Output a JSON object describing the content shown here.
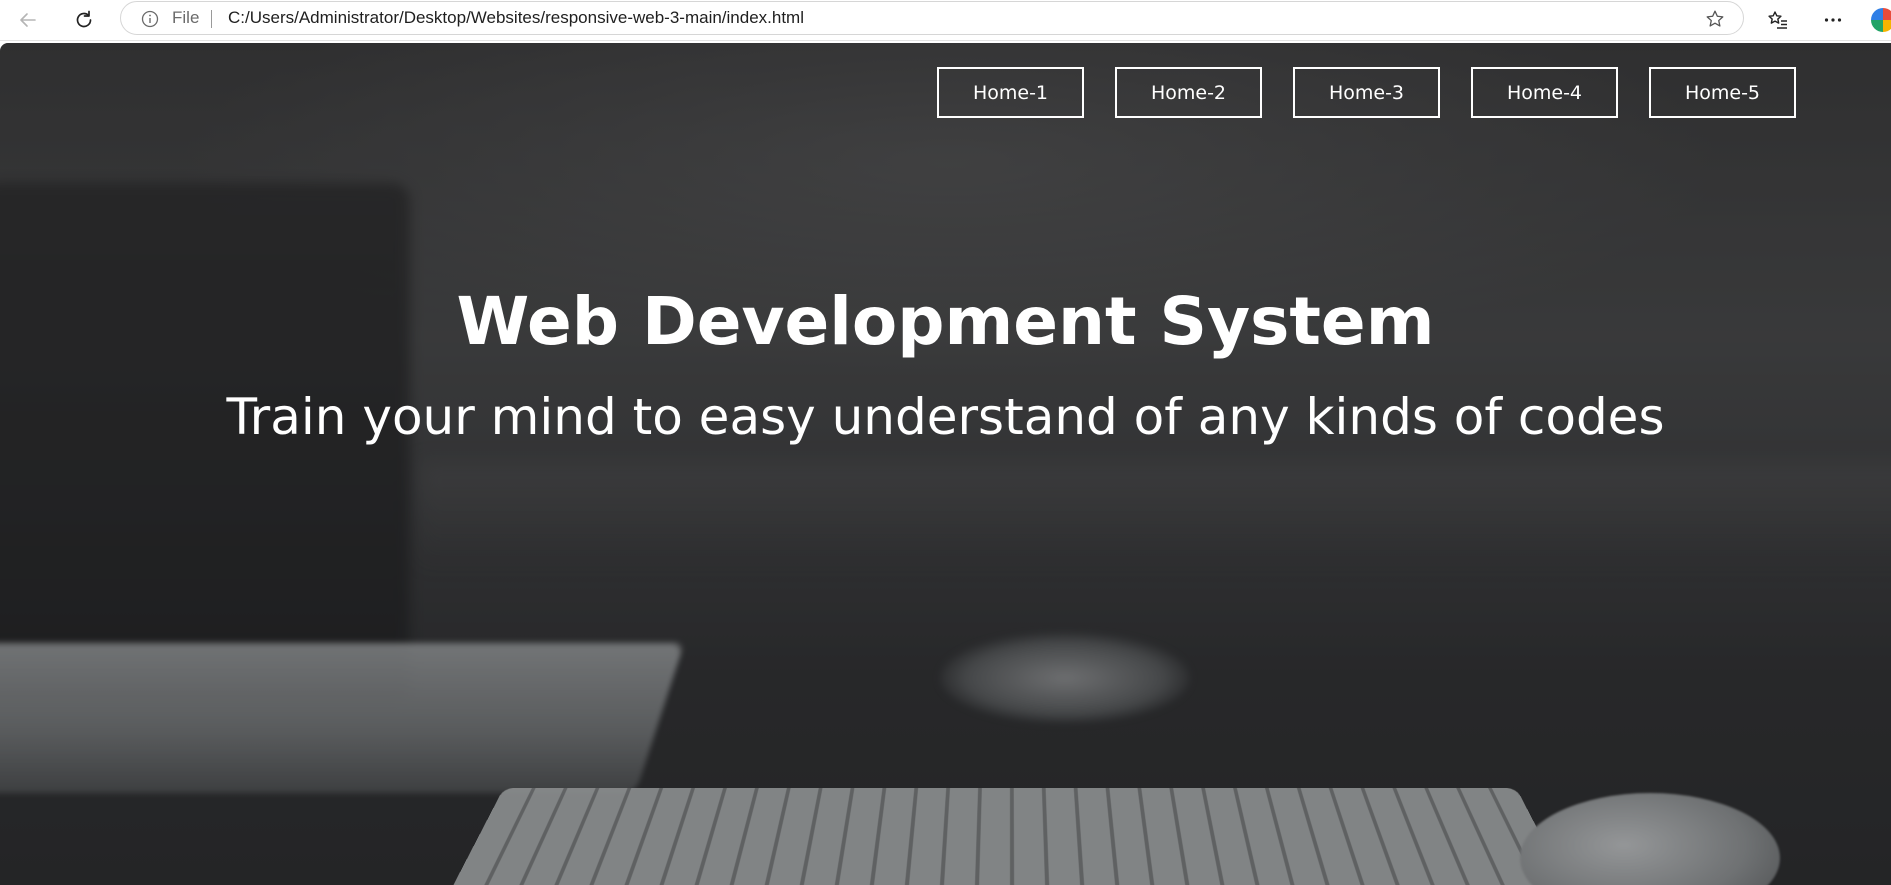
{
  "browser": {
    "address_bar": {
      "scheme_label": "File",
      "url": "C:/Users/Administrator/Desktop/Websites/responsive-web-3-main/index.html"
    },
    "icons": [
      "back-arrow-icon",
      "reload-icon",
      "info-icon",
      "star-icon",
      "favorites-icon",
      "more-icon"
    ]
  },
  "page": {
    "nav": [
      {
        "label": "Home-1"
      },
      {
        "label": "Home-2"
      },
      {
        "label": "Home-3"
      },
      {
        "label": "Home-4"
      },
      {
        "label": "Home-5"
      }
    ],
    "hero": {
      "title": "Web Development System",
      "subtitle": "Train your mind to easy understand of any kinds of codes"
    }
  },
  "colors": {
    "nav_border": "#ffffff",
    "hero_text": "#ffffff"
  }
}
